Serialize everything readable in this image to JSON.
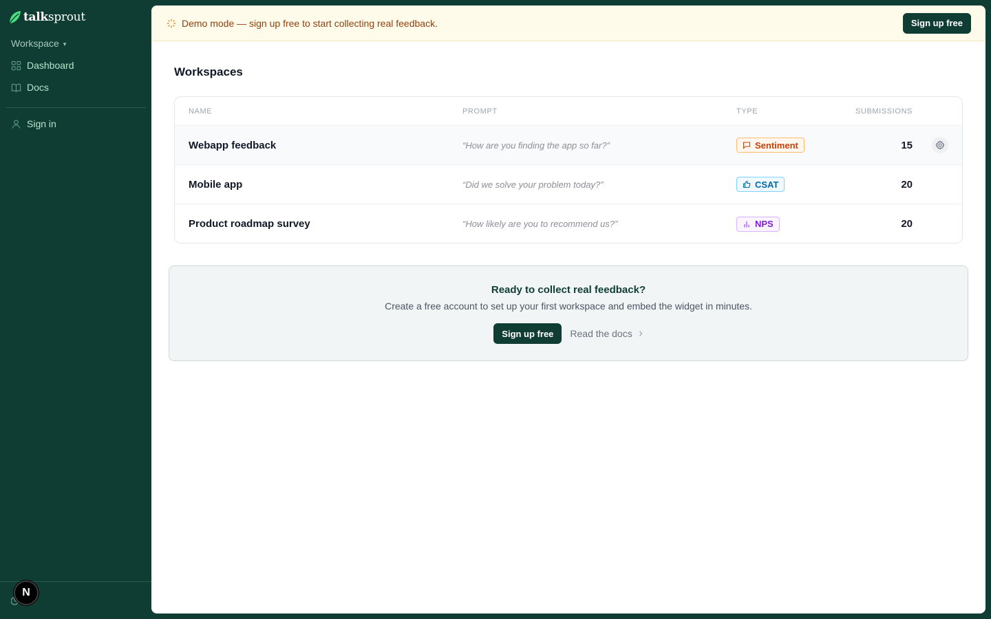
{
  "app": {
    "logo_bold": "talk",
    "logo_rest": "sprout",
    "colors": {
      "sidebar": "#0f3d33",
      "accent": "#0f3d33",
      "banner": "#fefbea"
    }
  },
  "sidebar": {
    "workspace_label": "Workspace",
    "items": [
      {
        "label": "Dashboard",
        "icon": "grid-icon"
      },
      {
        "label": "Docs",
        "icon": "book-icon"
      }
    ],
    "signin_label": "Sign in",
    "avatar_initial": "N"
  },
  "banner": {
    "text": "Demo mode — sign up free to start collecting real feedback.",
    "button": "Sign up free"
  },
  "page": {
    "title": "Workspaces"
  },
  "table": {
    "headers": {
      "name": "NAME",
      "prompt": "PROMPT",
      "type": "TYPE",
      "submissions": "SUBMISSIONS"
    },
    "rows": [
      {
        "name": "Webapp feedback",
        "prompt": "“How are you finding the app so far?”",
        "type": "Sentiment",
        "submissions": "15"
      },
      {
        "name": "Mobile app",
        "prompt": "“Did we solve your problem today?”",
        "type": "CSAT",
        "submissions": "20"
      },
      {
        "name": "Product roadmap survey",
        "prompt": "“How likely are you to recommend us?”",
        "type": "NPS",
        "submissions": "20"
      }
    ]
  },
  "cta": {
    "title": "Ready to collect real feedback?",
    "subtitle": "Create a free account to set up your first workspace and embed the widget in minutes.",
    "primary": "Sign up free",
    "secondary": "Read the docs"
  }
}
